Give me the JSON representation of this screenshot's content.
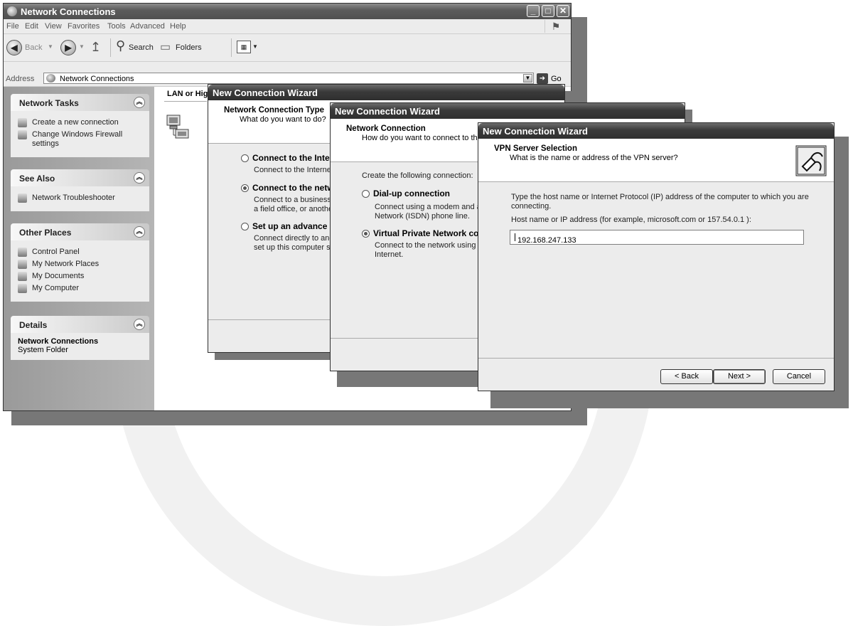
{
  "explorer": {
    "title": "Network Connections",
    "menu": [
      "File",
      "Edit",
      "View",
      "Favorites",
      "Tools",
      "Advanced",
      "Help"
    ],
    "toolbar": {
      "back": "Back",
      "search": "Search",
      "folders": "Folders"
    },
    "address": {
      "label": "Address",
      "value": "Network Connections",
      "go": "Go"
    },
    "panels": {
      "network_tasks": {
        "title": "Network Tasks",
        "items": [
          "Create a new connection",
          "Change Windows Firewall settings"
        ]
      },
      "see_also": {
        "title": "See Also",
        "items": [
          "Network Troubleshooter"
        ]
      },
      "other_places": {
        "title": "Other Places",
        "items": [
          "Control Panel",
          "My Network Places",
          "My Documents",
          "My Computer"
        ]
      },
      "details": {
        "title": "Details",
        "name": "Network Connections",
        "type": "System Folder"
      }
    },
    "list_header": "LAN or High"
  },
  "wizard1": {
    "title": "New Connection Wizard",
    "header_title": "Network Connection Type",
    "header_subtitle": "What do you want to do?",
    "options": [
      {
        "title": "Connect to the Inte",
        "desc": "Connect to the Internet",
        "selected": false
      },
      {
        "title": "Connect to the netw",
        "desc": "Connect to a business\na field office, or anothe",
        "selected": true
      },
      {
        "title": "Set up an advance",
        "desc": "Connect directly to anc\nset up this computer sc",
        "selected": false
      }
    ]
  },
  "wizard2": {
    "title": "New Connection Wizard",
    "header_title": "Network Connection",
    "header_subtitle": "How do you want to connect to the",
    "prompt": "Create the following connection:",
    "options": [
      {
        "title": "Dial-up connection",
        "desc": "Connect using a modem and a\nNetwork (ISDN) phone line.",
        "selected": false
      },
      {
        "title": "Virtual Private Network co",
        "desc": "Connect to the network using a\nInternet.",
        "selected": true
      }
    ]
  },
  "wizard3": {
    "title": "New Connection Wizard",
    "header_title": "VPN Server Selection",
    "header_subtitle": "What is the name or address of the VPN server?",
    "instruction": "Type the host name or Internet Protocol (IP) address of the computer to which you are\nconnecting.",
    "field_label": "Host name or IP address (for example, microsoft.com or 157.54.0.1 ):",
    "field_value": "192.168.247.133",
    "buttons": {
      "back": "< Back",
      "next": "Next >",
      "cancel": "Cancel"
    }
  }
}
